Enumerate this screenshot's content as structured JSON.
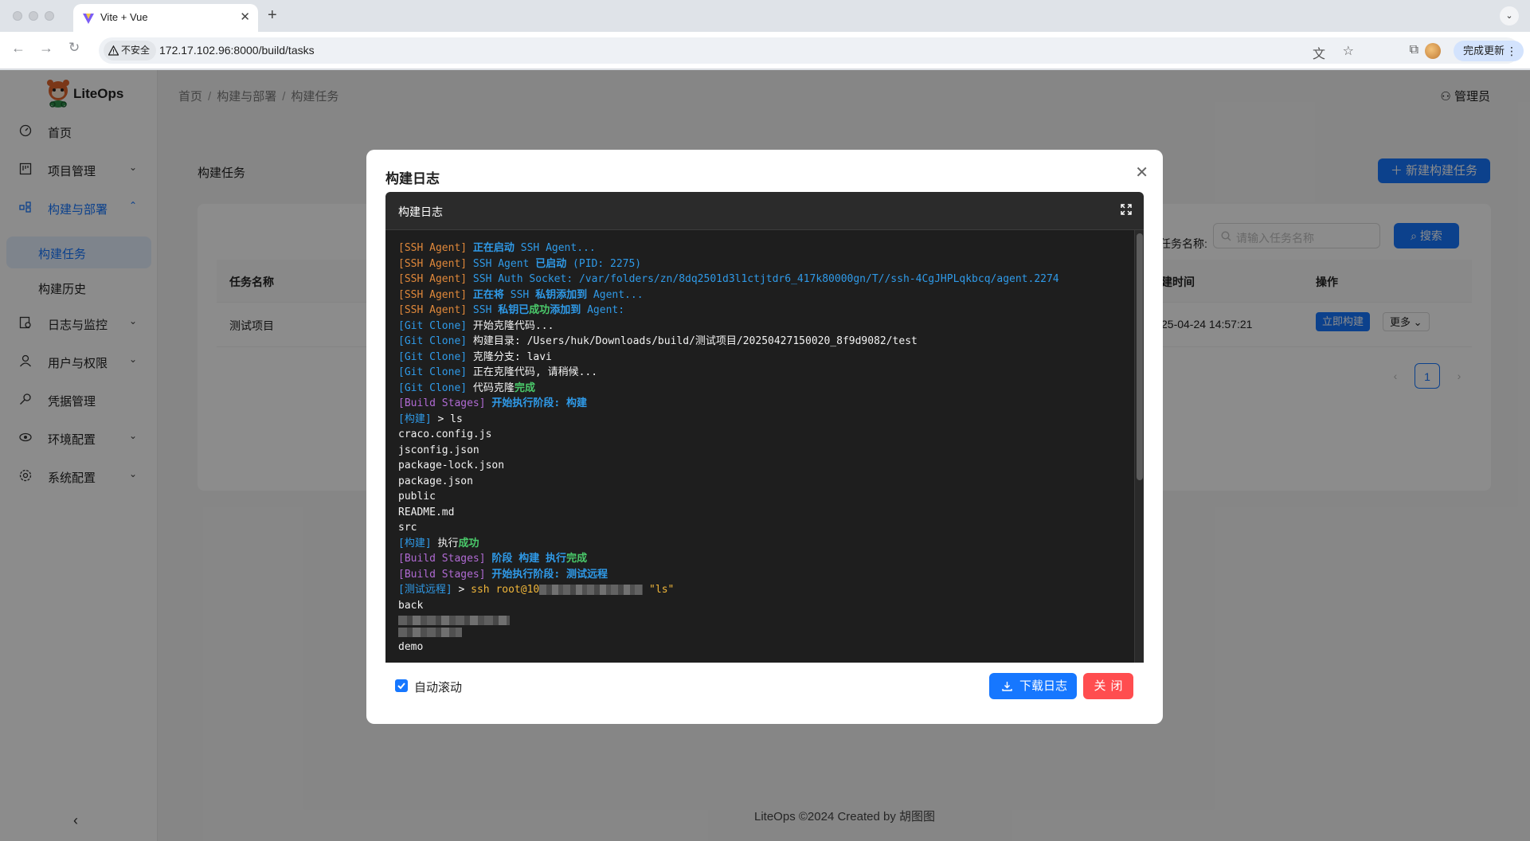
{
  "browser": {
    "tab_title": "Vite + Vue",
    "tab_close": "✕",
    "new_tab": "+",
    "security_label": "不安全",
    "url": "172.17.102.96:8000/build/tasks",
    "update_button": "完成更新"
  },
  "app": {
    "logo_text": "LiteOps",
    "menu": {
      "home": "首页",
      "project_mgmt": "项目管理",
      "build_deploy": "构建与部署",
      "build_tasks": "构建任务",
      "build_history": "构建历史",
      "logs_monitor": "日志与监控",
      "users_perms": "用户与权限",
      "credentials": "凭据管理",
      "env_config": "环境配置",
      "system_config": "系统配置"
    },
    "breadcrumb": [
      "首页",
      "构建与部署",
      "构建任务"
    ],
    "breadcrumb_sep": "/",
    "user": "管理员",
    "content_title": "构建任务",
    "new_task_button": "新建构建任务",
    "search_label": "任务名称:",
    "search_placeholder": "请输入任务名称",
    "search_button": "搜索",
    "table_headers": {
      "name": "任务名称",
      "time": "建时间",
      "actions": "操作"
    },
    "table_row": {
      "name": "测试项目",
      "time": "25-04-24 14:57:21",
      "build_now": "立即构建",
      "more": "更多"
    },
    "pagination": {
      "current": "1",
      "prev": "‹",
      "next": "›"
    },
    "footer": "LiteOps ©2024 Created by 胡图图",
    "collapse": "‹"
  },
  "modal": {
    "title": "构建日志",
    "close": "✕",
    "log_panel_title": "构建日志",
    "log_lines": [
      [
        [
          "c-orange",
          "[SSH Agent] "
        ],
        [
          "c-blueb",
          "正在启动"
        ],
        [
          "c-blue",
          " SSH Agent..."
        ]
      ],
      [
        [
          "c-orange",
          "[SSH Agent] "
        ],
        [
          "c-blue",
          "SSH Agent "
        ],
        [
          "c-blueb",
          "已启动"
        ],
        [
          "c-blue",
          " (PID: 2275)"
        ]
      ],
      [
        [
          "c-orange",
          "[SSH Agent] "
        ],
        [
          "c-blue",
          "SSH Auth Socket: /var/folders/zn/8dq2501d3l1ctjtdr6_417k80000gn/T//ssh-4CgJHPLqkbcq/agent.2274"
        ]
      ],
      [
        [
          "c-orange",
          "[SSH Agent] "
        ],
        [
          "c-blueb",
          "正在将"
        ],
        [
          "c-blue",
          " SSH "
        ],
        [
          "c-blueb",
          "私钥添加到"
        ],
        [
          "c-blue",
          " Agent..."
        ]
      ],
      [
        [
          "c-orange",
          "[SSH Agent] "
        ],
        [
          "c-blue",
          "SSH "
        ],
        [
          "c-blueb",
          "私钥已"
        ],
        [
          "c-green",
          "成功"
        ],
        [
          "c-blueb",
          "添加到"
        ],
        [
          "c-blue",
          " Agent:"
        ]
      ],
      [
        [
          "c-blue",
          "[Git Clone] "
        ],
        [
          "c-white",
          "开始克隆代码..."
        ]
      ],
      [
        [
          "c-blue",
          "[Git Clone] "
        ],
        [
          "c-white",
          "构建目录: /Users/huk/Downloads/build/测试项目/20250427150020_8f9d9082/test"
        ]
      ],
      [
        [
          "c-blue",
          "[Git Clone] "
        ],
        [
          "c-white",
          "克隆分支: lavi"
        ]
      ],
      [
        [
          "c-blue",
          "[Git Clone] "
        ],
        [
          "c-white",
          "正在克隆代码, 请稍候..."
        ]
      ],
      [
        [
          "c-blue",
          "[Git Clone] "
        ],
        [
          "c-white",
          "代码克隆"
        ],
        [
          "c-green",
          "完成"
        ]
      ],
      [
        [
          "c-purple",
          "[Build Stages] "
        ],
        [
          "c-blueb",
          "开始执行阶段: 构建"
        ]
      ],
      [
        [
          "c-blue",
          "[构建] "
        ],
        [
          "c-white",
          "> ls"
        ]
      ],
      [
        [
          "c-white",
          "craco.config.js"
        ]
      ],
      [
        [
          "c-white",
          "jsconfig.json"
        ]
      ],
      [
        [
          "c-white",
          "package-lock.json"
        ]
      ],
      [
        [
          "c-white",
          "package.json"
        ]
      ],
      [
        [
          "c-white",
          "public"
        ]
      ],
      [
        [
          "c-white",
          "README.md"
        ]
      ],
      [
        [
          "c-white",
          "src"
        ]
      ],
      [
        [
          "c-blue",
          "[构建] "
        ],
        [
          "c-white",
          "执行"
        ],
        [
          "c-green",
          "成功"
        ]
      ],
      [
        [
          "c-purple",
          "[Build Stages] "
        ],
        [
          "c-blueb",
          "阶段 构建 执行"
        ],
        [
          "c-green",
          "完成"
        ]
      ],
      [
        [
          "c-purple",
          "[Build Stages] "
        ],
        [
          "c-blueb",
          "开始执行阶段: 测试远程"
        ]
      ],
      [
        [
          "c-blue",
          "[测试远程] "
        ],
        [
          "c-white",
          "> "
        ],
        [
          "c-yellow",
          "ssh root@10"
        ],
        [
          "blur",
          ""
        ],
        [
          "c-yellow",
          " \"ls\""
        ]
      ],
      [
        [
          "c-white",
          "back"
        ]
      ],
      [
        [
          "blur-block",
          ""
        ]
      ],
      [
        [
          "blur-block",
          ""
        ]
      ],
      [
        [
          "c-white",
          "demo"
        ]
      ]
    ],
    "auto_scroll_label": "自动滚动",
    "auto_scroll_checked": true,
    "download_button": "下载日志",
    "close_button": "关闭"
  },
  "colors": {
    "primary": "#1677ff",
    "danger": "#ff4d4f",
    "log_bg": "#1e1e1e"
  },
  "icons": [
    "dashboard-icon",
    "project-icon",
    "deploy-icon",
    "log-icon",
    "user-icon",
    "key-icon",
    "env-icon",
    "settings-icon",
    "fullscreen-icon",
    "download-icon",
    "search-icon",
    "plus-icon",
    "user-avatar-icon",
    "close-icon"
  ]
}
